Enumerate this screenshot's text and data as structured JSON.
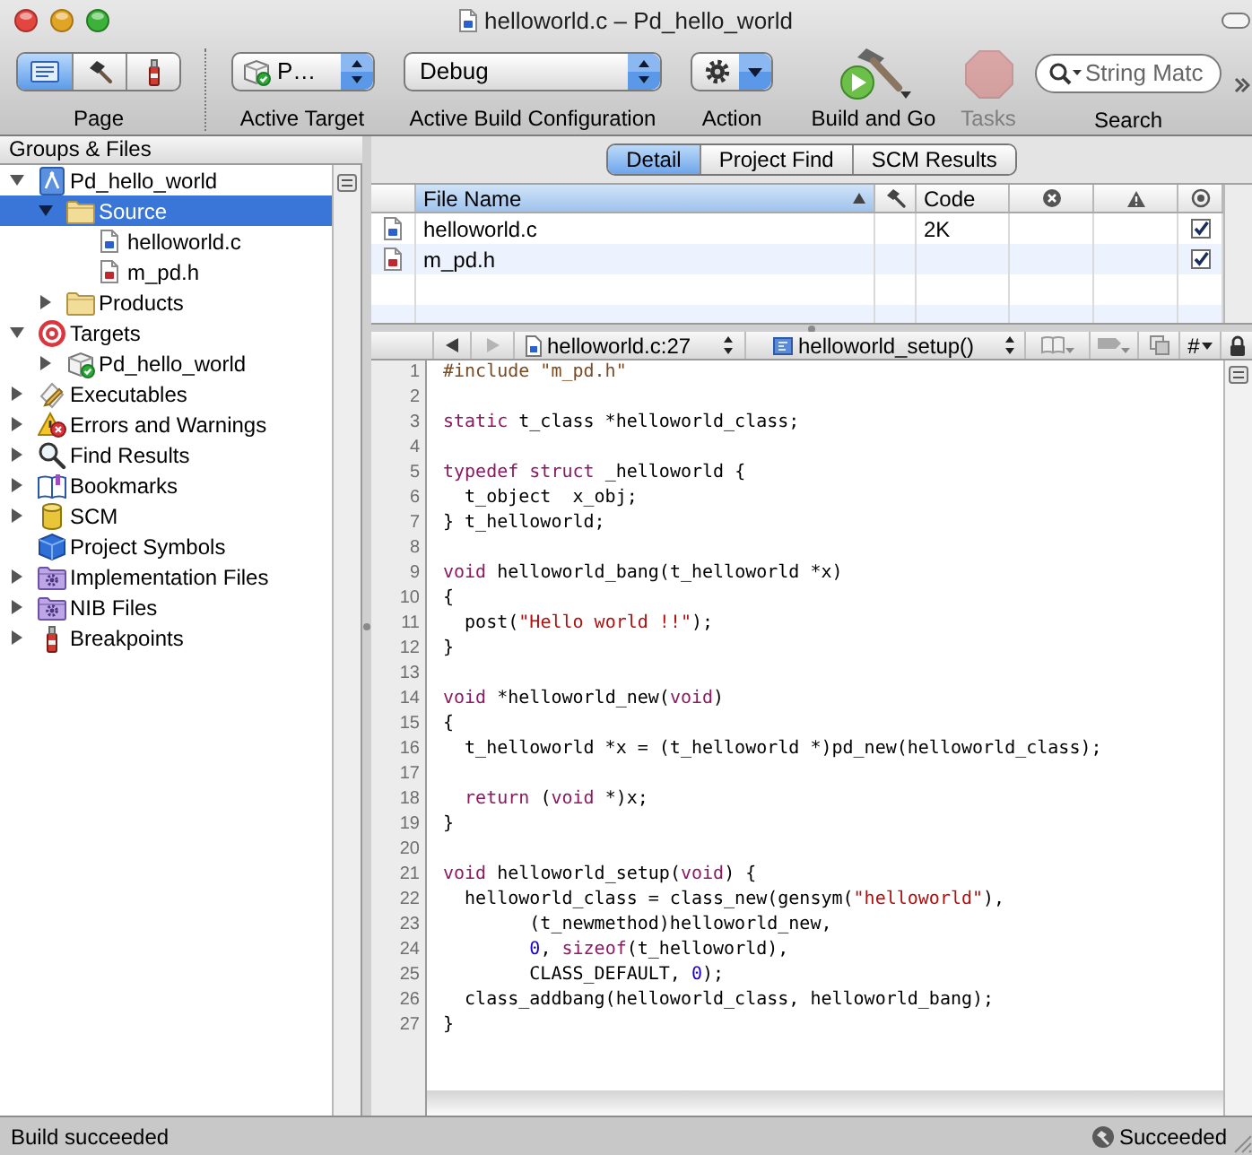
{
  "window": {
    "title": "helloworld.c – Pd_hello_world"
  },
  "toolbar": {
    "page": {
      "label": "Page",
      "segments": [
        {
          "kind": "editor",
          "selected": true
        },
        {
          "kind": "build",
          "selected": false
        },
        {
          "kind": "debug",
          "selected": false
        }
      ]
    },
    "active_target": {
      "value": "P…",
      "label": "Active Target"
    },
    "build_configuration": {
      "value": "Debug",
      "label": "Active Build Configuration"
    },
    "action": {
      "label": "Action"
    },
    "build_and_go": {
      "label": "Build and Go"
    },
    "tasks": {
      "label": "Tasks",
      "disabled": true
    },
    "search": {
      "placeholder": "String Matc",
      "label": "Search"
    }
  },
  "sidebar": {
    "header": "Groups & Files",
    "items": [
      {
        "kind": "project",
        "label": "Pd_hello_world",
        "expanded": true,
        "selected": false,
        "children": [
          {
            "kind": "folder",
            "label": "Source",
            "expanded": true,
            "selected": true,
            "children": [
              {
                "kind": "c_file",
                "label": "helloworld.c",
                "selected": false
              },
              {
                "kind": "h_file",
                "label": "m_pd.h",
                "selected": false
              }
            ]
          },
          {
            "kind": "folder",
            "label": "Products",
            "expanded": false,
            "selected": false
          }
        ]
      },
      {
        "kind": "targets",
        "label": "Targets",
        "expanded": true,
        "selected": false,
        "children": [
          {
            "kind": "target",
            "label": "Pd_hello_world",
            "expanded": false,
            "selected": false
          }
        ]
      },
      {
        "kind": "executables",
        "label": "Executables",
        "expanded": false,
        "selected": false
      },
      {
        "kind": "errors",
        "label": "Errors and Warnings",
        "expanded": false,
        "selected": false
      },
      {
        "kind": "find",
        "label": "Find Results",
        "expanded": false,
        "selected": false
      },
      {
        "kind": "bookmarks",
        "label": "Bookmarks",
        "expanded": false,
        "selected": false
      },
      {
        "kind": "scm",
        "label": "SCM",
        "expanded": false,
        "selected": false
      },
      {
        "kind": "symbols",
        "label": "Project Symbols",
        "selected": false
      },
      {
        "kind": "smart_group",
        "label": "Implementation Files",
        "expanded": false,
        "selected": false
      },
      {
        "kind": "smart_group",
        "label": "NIB Files",
        "expanded": false,
        "selected": false
      },
      {
        "kind": "breakpoints",
        "label": "Breakpoints",
        "expanded": false,
        "selected": false
      }
    ]
  },
  "detail_tabs": [
    {
      "label": "Detail",
      "selected": true
    },
    {
      "label": "Project Find",
      "selected": false
    },
    {
      "label": "SCM Results",
      "selected": false
    }
  ],
  "file_table": {
    "columns": [
      {
        "kind": "name",
        "label": "File Name",
        "sorted": true
      },
      {
        "kind": "build",
        "sorted": false
      },
      {
        "kind": "code",
        "label": "Code",
        "sorted": false
      },
      {
        "kind": "errors",
        "sorted": false
      },
      {
        "kind": "warnings",
        "sorted": false
      },
      {
        "kind": "target",
        "sorted": false
      }
    ],
    "rows": [
      {
        "kind": "c_file",
        "file_name": "helloworld.c",
        "code": "2K",
        "checked": true
      },
      {
        "kind": "h_file",
        "file_name": "m_pd.h",
        "checked": true
      }
    ]
  },
  "editor": {
    "nav_bar": {
      "back": {
        "disabled": false
      },
      "forward": {
        "disabled": true
      },
      "file_popup": "helloworld.c:27",
      "function_popup": "helloworld_setup()",
      "symbol_menu": "#"
    },
    "lines": [
      {
        "number": "1",
        "tokens": [
          {
            "kind": "preprocessor",
            "text": "#include \"m_pd.h\""
          }
        ]
      },
      {
        "number": "2"
      },
      {
        "number": "3",
        "tokens": [
          {
            "kind": "keyword",
            "text": "static"
          },
          {
            "kind": "plain",
            "text": " t_class *helloworld_class;"
          }
        ]
      },
      {
        "number": "4"
      },
      {
        "number": "5",
        "tokens": [
          {
            "kind": "keyword",
            "text": "typedef struct"
          },
          {
            "kind": "plain",
            "text": " _helloworld {"
          }
        ]
      },
      {
        "number": "6",
        "tokens": [
          {
            "kind": "plain",
            "text": "  t_object  x_obj;"
          }
        ]
      },
      {
        "number": "7",
        "tokens": [
          {
            "kind": "plain",
            "text": "} t_helloworld;"
          }
        ]
      },
      {
        "number": "8"
      },
      {
        "number": "9",
        "tokens": [
          {
            "kind": "keyword",
            "text": "void"
          },
          {
            "kind": "plain",
            "text": " helloworld_bang(t_helloworld *x)"
          }
        ]
      },
      {
        "number": "10",
        "tokens": [
          {
            "kind": "plain",
            "text": "{"
          }
        ]
      },
      {
        "number": "11",
        "tokens": [
          {
            "kind": "plain",
            "text": "  post("
          },
          {
            "kind": "string",
            "text": "\"Hello world !!\""
          },
          {
            "kind": "plain",
            "text": ");"
          }
        ]
      },
      {
        "number": "12",
        "tokens": [
          {
            "kind": "plain",
            "text": "}"
          }
        ]
      },
      {
        "number": "13"
      },
      {
        "number": "14",
        "tokens": [
          {
            "kind": "keyword",
            "text": "void"
          },
          {
            "kind": "plain",
            "text": " *helloworld_new("
          },
          {
            "kind": "keyword",
            "text": "void"
          },
          {
            "kind": "plain",
            "text": ")"
          }
        ]
      },
      {
        "number": "15",
        "tokens": [
          {
            "kind": "plain",
            "text": "{"
          }
        ]
      },
      {
        "number": "16",
        "tokens": [
          {
            "kind": "plain",
            "text": "  t_helloworld *x = (t_helloworld *)pd_new(helloworld_class);"
          }
        ]
      },
      {
        "number": "17"
      },
      {
        "number": "18",
        "tokens": [
          {
            "kind": "keyword",
            "text": "  return"
          },
          {
            "kind": "plain",
            "text": " ("
          },
          {
            "kind": "keyword",
            "text": "void"
          },
          {
            "kind": "plain",
            "text": " *)x;"
          }
        ]
      },
      {
        "number": "19",
        "tokens": [
          {
            "kind": "plain",
            "text": "}"
          }
        ]
      },
      {
        "number": "20"
      },
      {
        "number": "21",
        "tokens": [
          {
            "kind": "keyword",
            "text": "void"
          },
          {
            "kind": "plain",
            "text": " helloworld_setup("
          },
          {
            "kind": "keyword",
            "text": "void"
          },
          {
            "kind": "plain",
            "text": ") {"
          }
        ]
      },
      {
        "number": "22",
        "tokens": [
          {
            "kind": "plain",
            "text": "  helloworld_class = class_new(gensym("
          },
          {
            "kind": "string",
            "text": "\"helloworld\""
          },
          {
            "kind": "plain",
            "text": "),"
          }
        ]
      },
      {
        "number": "23",
        "tokens": [
          {
            "kind": "plain",
            "text": "        (t_newmethod)helloworld_new,"
          }
        ]
      },
      {
        "number": "24",
        "tokens": [
          {
            "kind": "number",
            "text": "        0"
          },
          {
            "kind": "plain",
            "text": ", "
          },
          {
            "kind": "keyword",
            "text": "sizeof"
          },
          {
            "kind": "plain",
            "text": "(t_helloworld),"
          }
        ]
      },
      {
        "number": "25",
        "tokens": [
          {
            "kind": "plain",
            "text": "        CLASS_DEFAULT, "
          },
          {
            "kind": "number",
            "text": "0"
          },
          {
            "kind": "plain",
            "text": ");"
          }
        ]
      },
      {
        "number": "26",
        "tokens": [
          {
            "kind": "plain",
            "text": "  class_addbang(helloworld_class, helloworld_bang);"
          }
        ]
      },
      {
        "number": "27",
        "tokens": [
          {
            "kind": "plain",
            "text": "}"
          }
        ]
      }
    ]
  },
  "status_bar": {
    "message": "Build succeeded",
    "build_status": "Succeeded"
  }
}
